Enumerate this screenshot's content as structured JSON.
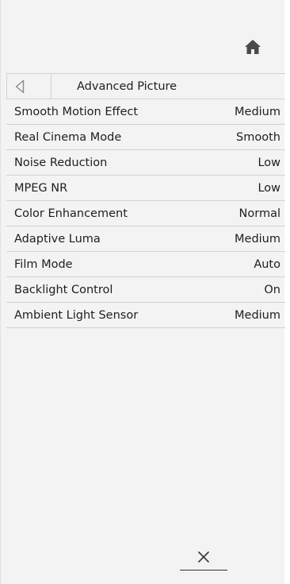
{
  "header": {
    "home_icon": "home-icon",
    "title": "Advanced Picture",
    "back_icon": "back-triangle-icon"
  },
  "menu": {
    "items": [
      {
        "label": "Smooth Motion Effect",
        "value": "Medium"
      },
      {
        "label": "Real Cinema Mode",
        "value": "Smooth"
      },
      {
        "label": "Noise Reduction",
        "value": "Low"
      },
      {
        "label": "MPEG NR",
        "value": "Low"
      },
      {
        "label": "Color Enhancement",
        "value": "Normal"
      },
      {
        "label": "Adaptive Luma",
        "value": "Medium"
      },
      {
        "label": "Film Mode",
        "value": "Auto"
      },
      {
        "label": "Backlight Control",
        "value": "On"
      },
      {
        "label": "Ambient Light Sensor",
        "value": "Medium"
      }
    ]
  },
  "footer": {
    "close_icon": "close-icon"
  },
  "colors": {
    "background": "#f3f3f3",
    "divider": "#d2d2d2",
    "text": "#1e1e1e",
    "icon": "#4a4a4a"
  }
}
